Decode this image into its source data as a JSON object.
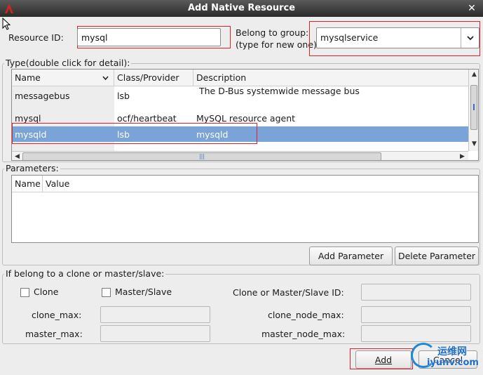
{
  "window": {
    "title": "Add Native Resource"
  },
  "resource_id": {
    "label": "Resource ID:",
    "value": "mysql"
  },
  "group": {
    "label_line1": "Belong to group:",
    "label_line2": "(type for new one)",
    "value": "mysqlservice"
  },
  "type_section": {
    "title": "Type(double click for detail):",
    "columns": [
      "Name",
      "Class/Provider",
      "Description"
    ],
    "rows": [
      {
        "name": "messagebus",
        "class": "lsb",
        "description": "The D-Bus systemwide message bus"
      },
      {
        "name": "mysql",
        "class": "ocf/heartbeat",
        "description": "MySQL resource agent"
      },
      {
        "name": "mysqld",
        "class": "lsb",
        "description": "mysqld"
      }
    ]
  },
  "parameters": {
    "title": "Parameters:",
    "columns": [
      "Name",
      "Value"
    ],
    "add_label": "Add Parameter",
    "delete_label": "Delete Parameter"
  },
  "clone": {
    "title": "If belong to a clone or master/slave:",
    "clone_label": "Clone",
    "master_slave_label": "Master/Slave",
    "id_label": "Clone or Master/Slave ID:",
    "clone_max_label": "clone_max:",
    "clone_node_max_label": "clone_node_max:",
    "master_max_label": "master_max:",
    "master_node_max_label": "master_node_max:"
  },
  "buttons": {
    "add": "Add",
    "cancel": "Cancel"
  },
  "watermark": {
    "text_top": "运维网",
    "text_bottom": "iyunv.com"
  },
  "colors": {
    "selection": "#7aa3d8",
    "highlight_box": "#e0202a",
    "titlebar": "#3a3a3a"
  }
}
